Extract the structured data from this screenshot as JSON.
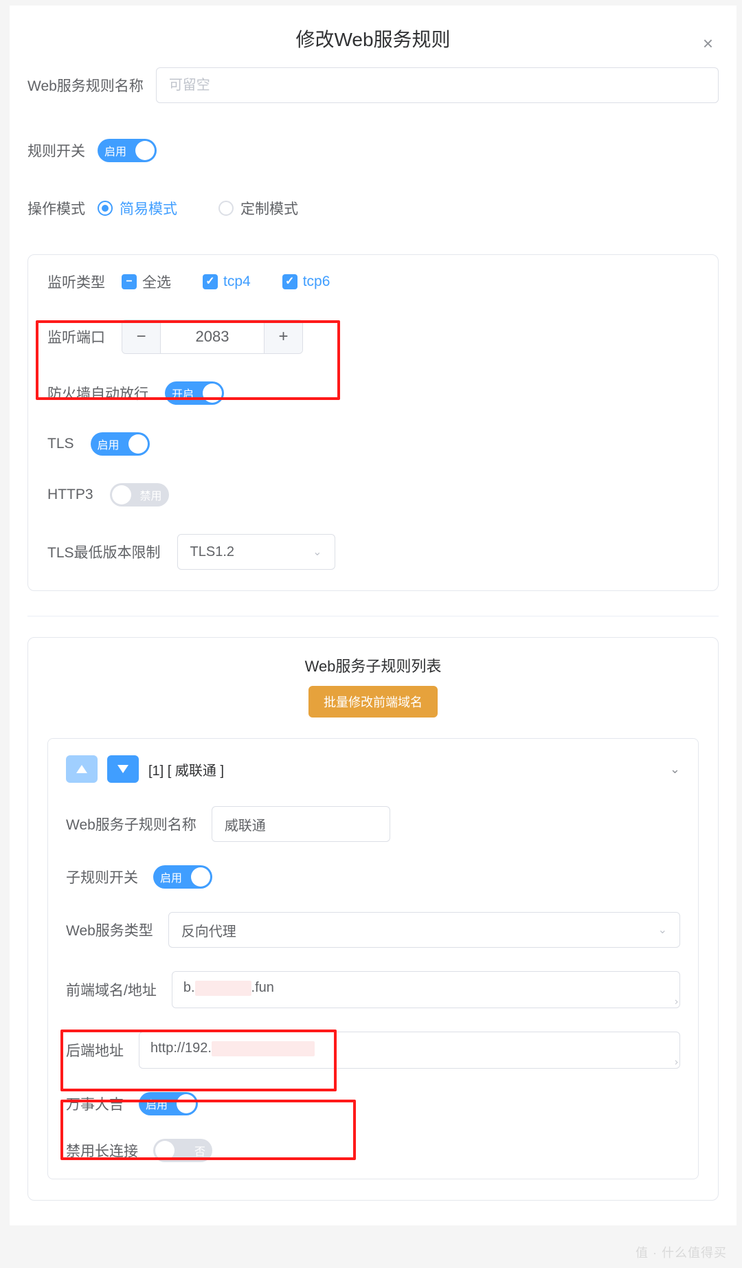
{
  "modal": {
    "title": "修改Web服务规则",
    "name_label": "Web服务规则名称",
    "name_placeholder": "可留空",
    "name_value": "",
    "rule_switch_label": "规则开关",
    "rule_switch_text": "启用",
    "mode_label": "操作模式",
    "mode_simple": "简易模式",
    "mode_custom": "定制模式"
  },
  "listen": {
    "type_label": "监听类型",
    "select_all": "全选",
    "tcp4": "tcp4",
    "tcp6": "tcp6",
    "port_label": "监听端口",
    "port_value": "2083",
    "fw_label": "防火墙自动放行",
    "fw_text": "开启",
    "tls_label": "TLS",
    "tls_text": "启用",
    "http3_label": "HTTP3",
    "http3_text": "禁用",
    "tls_min_label": "TLS最低版本限制",
    "tls_min_value": "TLS1.2"
  },
  "sub": {
    "list_title": "Web服务子规则列表",
    "batch_btn": "批量修改前端域名",
    "item_title": "[1] [ 威联通 ]",
    "name_label": "Web服务子规则名称",
    "name_value": "威联通",
    "switch_label": "子规则开关",
    "switch_text": "启用",
    "type_label": "Web服务类型",
    "type_value": "反向代理",
    "front_label": "前端域名/地址",
    "front_prefix": "b.",
    "front_suffix": ".fun",
    "back_label": "后端地址",
    "back_prefix": "http://192.",
    "ok_label": "万事大吉",
    "ok_text": "启用",
    "keepalive_label": "禁用长连接",
    "keepalive_text": "否"
  },
  "watermark": "值 · 什么值得买"
}
